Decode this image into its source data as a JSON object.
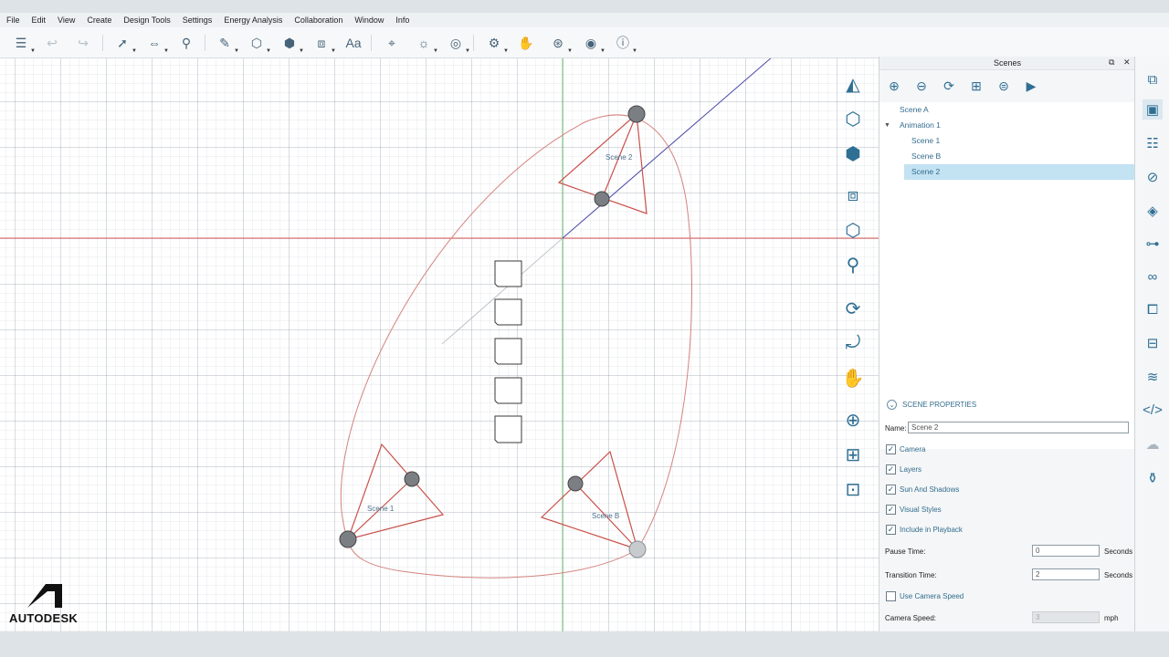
{
  "menu": [
    "File",
    "Edit",
    "View",
    "Create",
    "Design Tools",
    "Settings",
    "Energy Analysis",
    "Collaboration",
    "Window",
    "Info"
  ],
  "toolbar_icons": [
    "layers-icon",
    "undo-icon",
    "redo-icon",
    "select-icon",
    "dimension-icon",
    "paint-icon",
    "pencil-icon",
    "shape-icon",
    "solid-icon",
    "push-pull-icon",
    "section-icon",
    "text-icon",
    "location-icon",
    "sun-icon",
    "scale-icon",
    "settings-icon",
    "hand-icon",
    "share-icon",
    "user-icon",
    "info-icon"
  ],
  "viewport": {
    "scene_labels": [
      "Scene 2",
      "Scene 1",
      "Scene B"
    ],
    "colors": {
      "x_axis": "#e05a5a",
      "y_axis": "#6dbf73",
      "z_axis": "#4a4aa8",
      "camera": "#c9504a"
    }
  },
  "brand": {
    "name": "AUTODESK"
  },
  "panel": {
    "title": "Scenes",
    "float_glyph": "⧉",
    "close_glyph": "✕",
    "tools": [
      "add-icon",
      "remove-icon",
      "refresh-icon",
      "add-animation-icon",
      "stop-icon",
      "play-icon"
    ],
    "tree": [
      {
        "label": "Scene A",
        "indent": 0,
        "selected": false
      },
      {
        "label": "Animation 1",
        "indent": 0,
        "expanded": true,
        "selected": false
      },
      {
        "label": "Scene 1",
        "indent": 1,
        "selected": false
      },
      {
        "label": "Scene B",
        "indent": 1,
        "selected": false
      },
      {
        "label": "Scene 2",
        "indent": 1,
        "selected": true
      }
    ],
    "properties": {
      "header": "SCENE PROPERTIES",
      "name_label": "Name:",
      "name_value": "Scene 2",
      "checkboxes": [
        {
          "label": "Camera",
          "checked": true
        },
        {
          "label": "Layers",
          "checked": true
        },
        {
          "label": "Sun And Shadows",
          "checked": true
        },
        {
          "label": "Visual Styles",
          "checked": true
        },
        {
          "label": "Include in Playback",
          "checked": true
        }
      ],
      "pause_label": "Pause Time:",
      "pause_value": "0",
      "pause_unit": "Seconds",
      "transition_label": "Transition Time:",
      "transition_value": "2",
      "transition_unit": "Seconds",
      "use_camera_speed_label": "Use Camera Speed",
      "use_camera_speed_checked": false,
      "camera_speed_label": "Camera Speed:",
      "camera_speed_value": "3",
      "camera_speed_unit": "mph"
    }
  },
  "right_sidebar_icons": [
    "model-icon",
    "scenes-icon",
    "properties-icon",
    "styles-icon",
    "layers-icon",
    "align-icon",
    "glasses-icon",
    "components-icon",
    "outliner-icon",
    "materials-icon",
    "code-icon",
    "cloud-icon",
    "paint-icon"
  ]
}
